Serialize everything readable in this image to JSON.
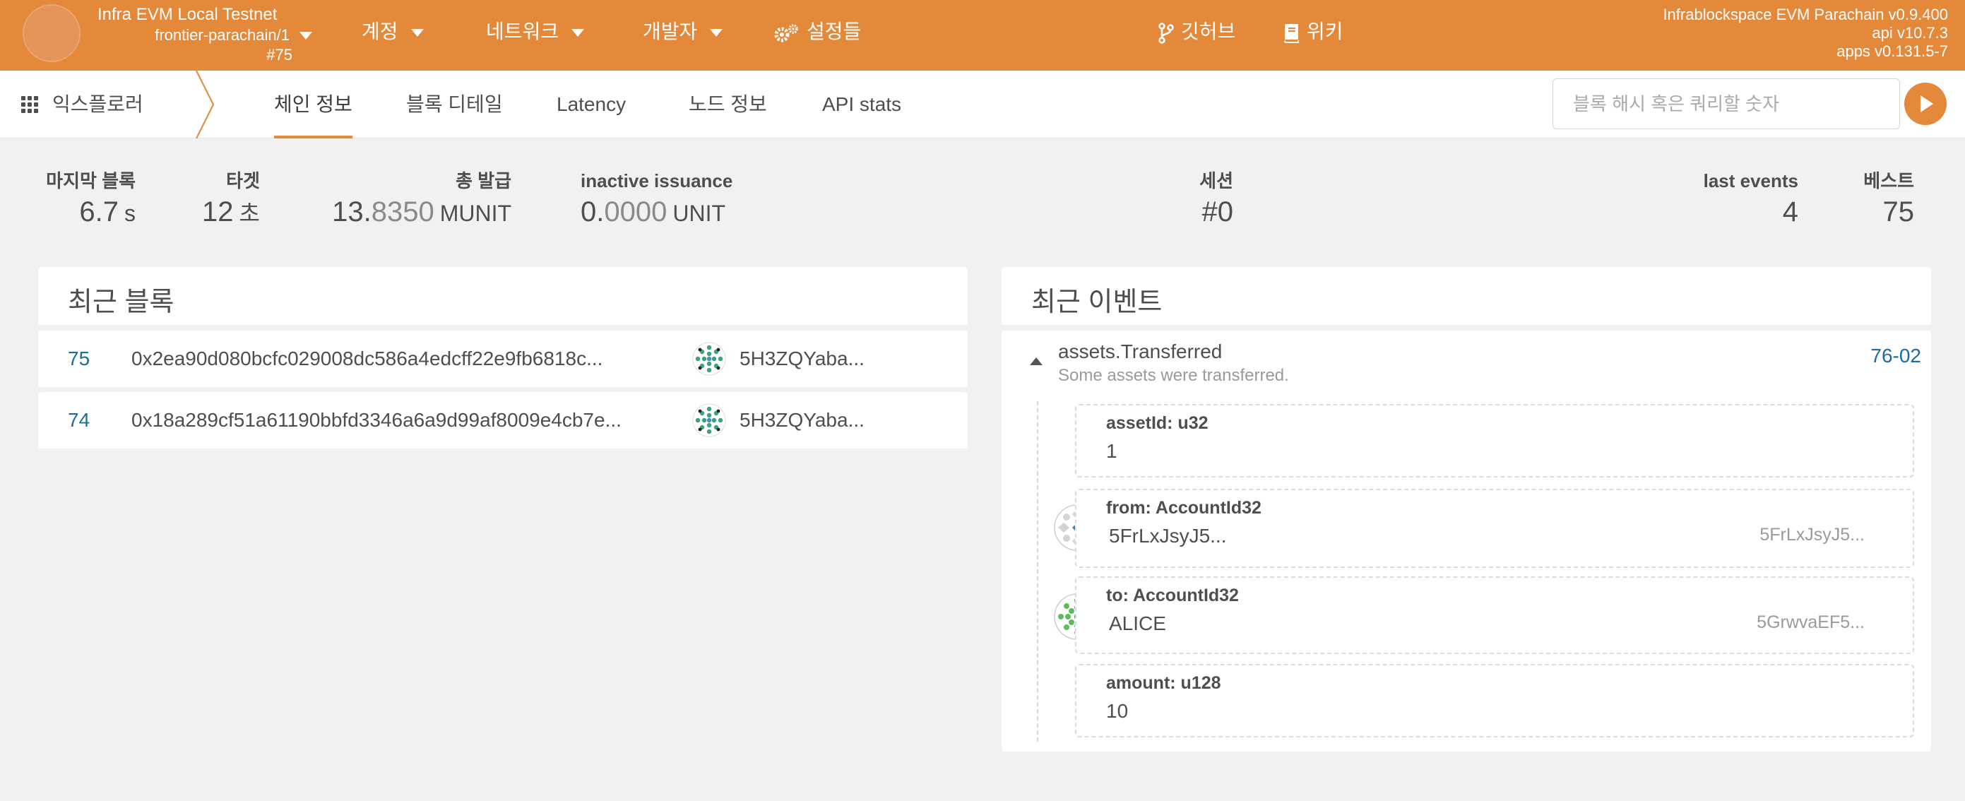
{
  "topbar": {
    "chain_name": "Infra EVM Local Testnet",
    "chain_spec": "frontier-parachain/1",
    "best_block": "#75",
    "menus": [
      {
        "label": "계정"
      },
      {
        "label": "네트워크"
      },
      {
        "label": "개발자"
      },
      {
        "label": "설정들"
      }
    ],
    "links": [
      {
        "label": "깃허브",
        "icon": "github-fork-icon"
      },
      {
        "label": "위키",
        "icon": "book-icon"
      }
    ],
    "version_lines": [
      "Infrablockspace EVM Parachain v0.9.400",
      "api v10.7.3",
      "apps v0.131.5-7"
    ]
  },
  "tabbar": {
    "app_label": "익스플로러",
    "tabs": [
      {
        "label": "체인 정보",
        "active": true
      },
      {
        "label": "블록 디테일",
        "active": false
      },
      {
        "label": "Latency",
        "active": false
      },
      {
        "label": "노드 정보",
        "active": false
      },
      {
        "label": "API stats",
        "active": false
      }
    ],
    "search_placeholder": "블록 해시 혹은 쿼리할 숫자"
  },
  "summary": {
    "last_block": {
      "label": "마지막 블록",
      "value": "6.7",
      "unit": "s"
    },
    "target": {
      "label": "타겟",
      "value": "12",
      "unit": "초"
    },
    "total_issuance": {
      "label": "총 발급",
      "int": "13.",
      "dec": "8350",
      "unit": "MUNIT"
    },
    "inactive_issuance": {
      "label": "inactive issuance",
      "int": "0.",
      "dec": "0000",
      "unit": "UNIT"
    },
    "session": {
      "label": "세션",
      "value": "#0"
    },
    "last_events": {
      "label": "last events",
      "value": "4"
    },
    "best": {
      "label": "베스트",
      "value": "75"
    }
  },
  "recent_blocks": {
    "title": "최근 블록",
    "rows": [
      {
        "number": "75",
        "hash": "0x2ea90d080bcfc029008dc586a4edcff22e9fb6818c...",
        "author": "5H3ZQYaba..."
      },
      {
        "number": "74",
        "hash": "0x18a289cf51a61190bbfd3346a6a9d99af8009e4cb7e...",
        "author": "5H3ZQYaba..."
      }
    ]
  },
  "recent_events": {
    "title": "최근 이벤트",
    "event": {
      "name": "assets.Transferred",
      "description": "Some assets were transferred.",
      "link": "76-02",
      "params": [
        {
          "label": "assetId: u32",
          "value": "1"
        },
        {
          "label": "from: AccountId32",
          "value": "5FrLxJsyJ5...",
          "address": "5FrLxJsyJ5..."
        },
        {
          "label": "to: AccountId32",
          "value": "ALICE",
          "address": "5GrwvaEF5..."
        },
        {
          "label": "amount: u128",
          "value": "10"
        }
      ]
    }
  },
  "colors": {
    "accent": "#e4883a",
    "link": "#1c6ca1",
    "background": "#f2f1f0"
  }
}
